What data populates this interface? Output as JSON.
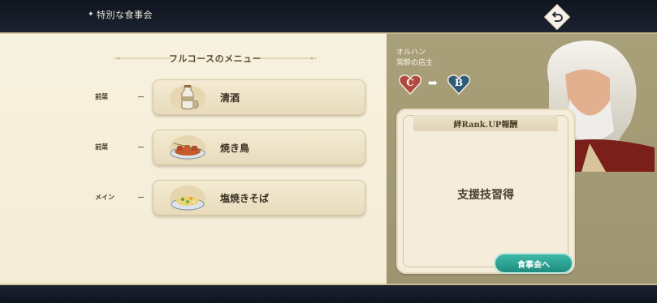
{
  "header": {
    "title": "特別な食事会",
    "icon": "diamond-icon",
    "back_icon": "return-arrow-icon"
  },
  "menu": {
    "title": "フルコースのメニュー",
    "courses": [
      {
        "label": "前菜",
        "dish": "清酒",
        "icon": "sake-bottle-icon"
      },
      {
        "label": "前菜",
        "dish": "焼き鳥",
        "icon": "yakitori-plate-icon"
      },
      {
        "label": "メイン",
        "dish": "塩焼きそば",
        "icon": "yakisoba-plate-icon"
      }
    ]
  },
  "character": {
    "name": "オルハン",
    "title": "常酔の店主",
    "rank_from": "C",
    "rank_to": "B"
  },
  "reward": {
    "header": "絆Rank.UP報酬",
    "text": "支援技習得",
    "button": "食事会へ"
  },
  "colors": {
    "panel_cream": "#f7f1df",
    "panel_olive": "#a9a079",
    "button_teal": "#2aa596",
    "rank_c": "#b2493e",
    "rank_b": "#2f5a78"
  }
}
